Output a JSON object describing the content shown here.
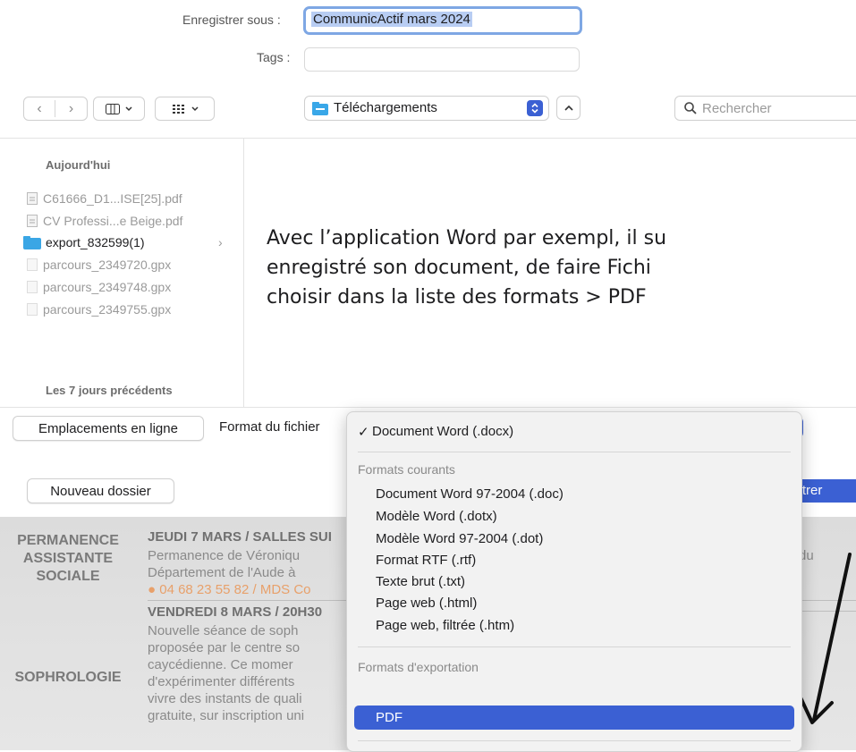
{
  "save_as": {
    "label": "Enregistrer sous :",
    "value": "CommunicActif mars 2024"
  },
  "tags": {
    "label": "Tags :",
    "value": ""
  },
  "location": {
    "name": "Téléchargements"
  },
  "search": {
    "placeholder": "Rechercher"
  },
  "sidebar": {
    "today_title": "Aujourd'hui",
    "files": [
      "C61666_D1...ISE[25].pdf",
      "CV Professi...e Beige.pdf",
      "export_832599(1)",
      "parcours_2349720.gpx",
      "parcours_2349748.gpx",
      "parcours_2349755.gpx"
    ],
    "prev_title": "Les 7 jours précédents"
  },
  "overlay_text": {
    "line1": "Avec l’application Word par exempl, il su",
    "line2": "enregistré son document, de faire Fichi",
    "line3": "choisir dans la liste des formats > PDF"
  },
  "bottom": {
    "online_locations": "Emplacements en ligne",
    "format_label": "Format du fichier",
    "new_folder": "Nouveau dossier",
    "save_partial": "istrer"
  },
  "menu": {
    "selected": "Document Word (.docx)",
    "header_common": "Formats courants",
    "common": [
      "Document Word 97-2004 (.doc)",
      "Modèle Word (.dotx)",
      "Modèle Word 97-2004 (.dot)",
      "Format RTF (.rtf)",
      "Texte brut (.txt)",
      "Page web (.html)",
      "Page web, filtrée (.htm)"
    ],
    "header_export": "Formats d'exportation",
    "export_selected": "PDF"
  },
  "document": {
    "cat1": "PERMANENCE\nASSISTANTE\nSOCIALE",
    "head1": "JEUDI 7 MARS / SALLES SUI",
    "text1": [
      "Permanence de Véroniqu",
      "Département de l'Aude à"
    ],
    "contact1": "● 04 68 23 55 82 / MDS Co",
    "cat2": "SOPHROLOGIE",
    "head2": "VENDREDI 8 MARS / 20H30",
    "text2": [
      "Nouvelle séance de soph",
      "proposée par le centre so",
      "caycédienne. Ce momer",
      "d'expérimenter différents",
      "vivre des instants de quali",
      "gratuite, sur inscription uni"
    ],
    "right_snip": "du"
  },
  "colors": {
    "accent": "#3b60d3",
    "focus_ring": "#7ea7e4",
    "contact": "#e8a06a"
  }
}
